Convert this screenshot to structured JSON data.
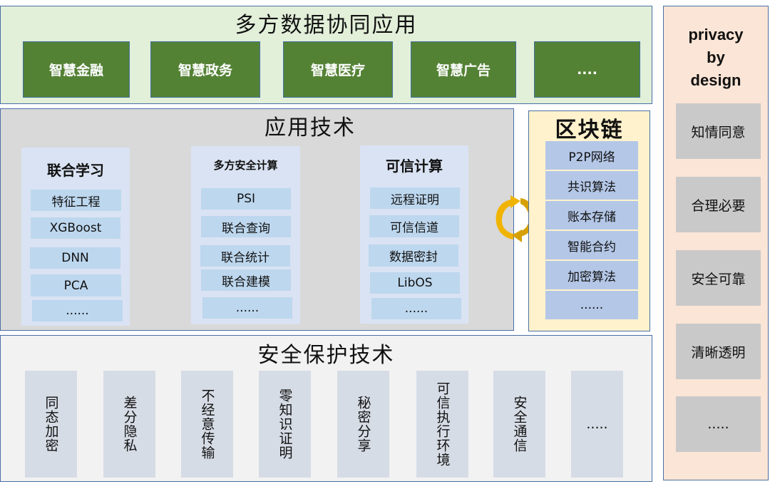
{
  "application_layer": {
    "title": "多方数据协同应用",
    "items": [
      "智慧金融",
      "智慧政务",
      "智慧医疗",
      "智慧广告",
      "...."
    ]
  },
  "tech_layer": {
    "title": "应用技术",
    "columns": [
      {
        "title": "联合学习",
        "items": [
          "特征工程",
          "XGBoost",
          "DNN",
          "PCA",
          "......"
        ]
      },
      {
        "title": "多方安全计算",
        "items": [
          "PSI",
          "联合查询",
          "联合统计",
          "联合建模",
          "......"
        ]
      },
      {
        "title": "可信计算",
        "items": [
          "远程证明",
          "可信信道",
          "数据密封",
          "LibOS",
          "......"
        ]
      }
    ]
  },
  "blockchain": {
    "title": "区块链",
    "items": [
      "P2P网络",
      "共识算法",
      "账本存储",
      "智能合约",
      "加密算法",
      "......"
    ]
  },
  "connector": {
    "icon": "bidirectional-cycle-arrows",
    "color": "#e8a600"
  },
  "security_layer": {
    "title": "安全保护技术",
    "items": [
      "同态加密",
      "差分隐私",
      "不经意传输",
      "零知识证明",
      "秘密分享",
      "可信执行环境",
      "安全通信",
      "....."
    ]
  },
  "privacy_by_design": {
    "title_lines": [
      "privacy",
      "by",
      "design"
    ],
    "items": [
      "知情同意",
      "合理必要",
      "安全可靠",
      "清晰透明",
      "....."
    ]
  },
  "colors": {
    "app_bg": "#e2efd9",
    "app_box": "#548235",
    "tech_bg": "#d9d9d9",
    "tech_col": "#dae3f3",
    "tech_item": "#bdd7ee",
    "blockchain_bg": "#fff2cc",
    "blockchain_item": "#b4c7e7",
    "security_bg": "#f2f2f2",
    "security_item": "#d6dce5",
    "pbd_bg": "#fbe5d6",
    "pbd_item": "#c9c9c9",
    "border": "#4a6fa5"
  }
}
